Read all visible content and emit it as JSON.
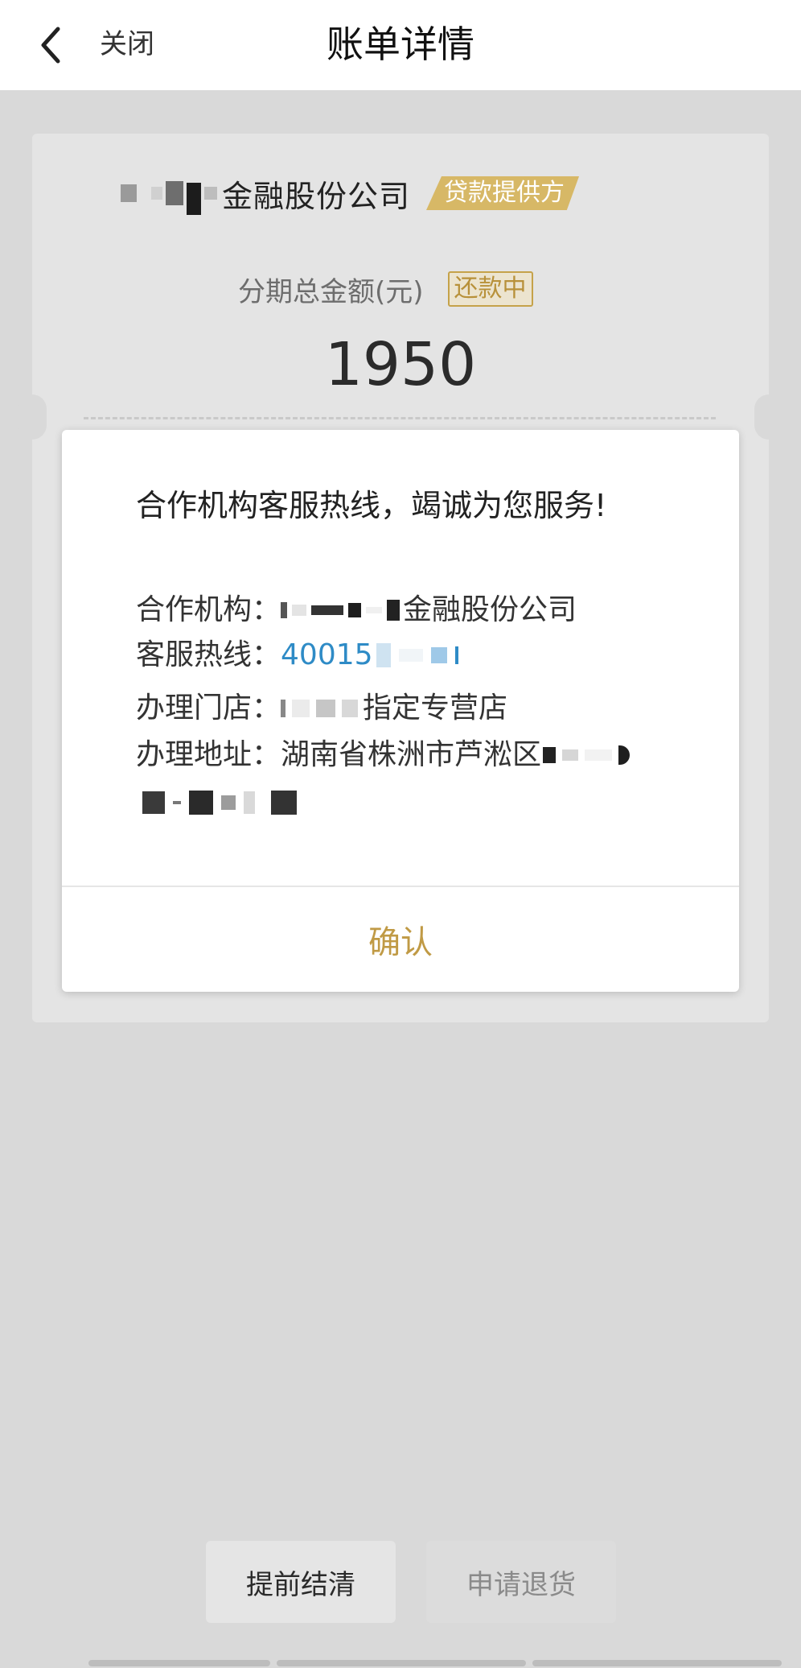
{
  "navbar": {
    "title": "账单详情",
    "close_label": "关闭",
    "back_icon": "chevron-left-icon"
  },
  "card": {
    "provider_name": "金融股份公司",
    "provider_badge": "贷款提供方",
    "amount_label": "分期总金额(元)",
    "status_badge": "还款中",
    "amount_value": "1950"
  },
  "dialog": {
    "heading": "合作机构客服热线，竭诚为您服务!",
    "rows": [
      {
        "label": "合作机构：",
        "value": "金融股份公司"
      },
      {
        "label": "客服热线：",
        "value": "40015"
      },
      {
        "label": "办理门店：",
        "value": "指定专营店"
      },
      {
        "label": "办理地址：",
        "value": "湖南省株洲市芦淞区"
      }
    ],
    "confirm_label": "确认"
  },
  "actions": {
    "settle_label": "提前结清",
    "return_label": "申请退货"
  },
  "colors": {
    "accent_gold": "#c09a45",
    "badge_gold": "#d7b866",
    "hotline_blue": "#2e8bc6",
    "page_bg": "#d9d9d9"
  }
}
